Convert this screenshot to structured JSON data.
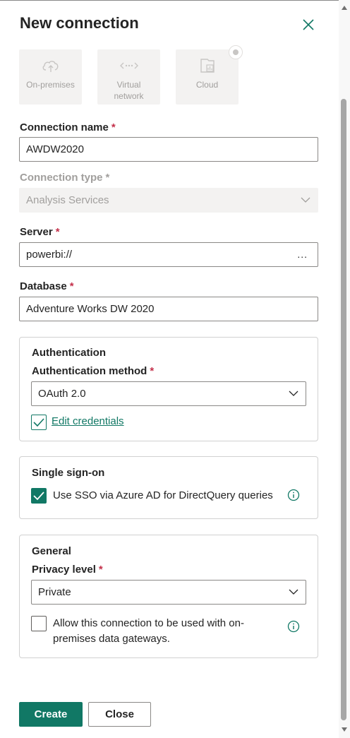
{
  "dialog": {
    "title": "New connection"
  },
  "tiles": [
    {
      "label": "On-premises",
      "icon": "cloud-upload-icon"
    },
    {
      "label": "Virtual network",
      "icon": "virtual-network-icon"
    },
    {
      "label": "Cloud",
      "icon": "cloud-report-icon"
    }
  ],
  "connection_name": {
    "label": "Connection name",
    "required": "*",
    "value": "AWDW2020"
  },
  "connection_type": {
    "label": "Connection type",
    "required": "*",
    "value": "Analysis Services"
  },
  "server": {
    "label": "Server",
    "required": "*",
    "value": "powerbi://",
    "more": "..."
  },
  "database": {
    "label": "Database",
    "required": "*",
    "value": "Adventure Works DW 2020"
  },
  "authentication": {
    "title": "Authentication",
    "method_label": "Authentication method",
    "required": "*",
    "method_value": "OAuth 2.0",
    "edit_credentials": "Edit credentials"
  },
  "sso": {
    "title": "Single sign-on",
    "checkbox_label": "Use SSO via Azure AD for DirectQuery queries",
    "checked": true
  },
  "general": {
    "title": "General",
    "privacy_label": "Privacy level",
    "required": "*",
    "privacy_value": "Private",
    "gateway_line1": "Allow this connection to be used with on-",
    "gateway_line2": "premises data gateways.",
    "gateway_checked": false
  },
  "buttons": {
    "create": "Create",
    "close": "Close"
  },
  "colors": {
    "accent": "#117865",
    "required": "#c4314b",
    "disabled_bg": "#f3f2f1"
  }
}
